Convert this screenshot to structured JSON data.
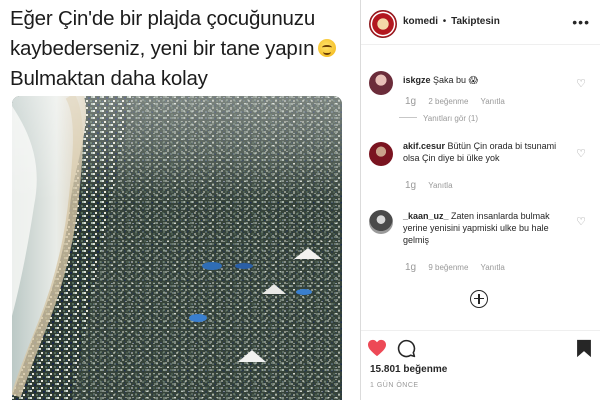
{
  "post": {
    "caption_lines": [
      "Eğer Çin'de bir plajda çocuğunuzu",
      "kaybederseniz, yeni bir tane yapın",
      "Bulmaktan daha kolay"
    ],
    "caption_emoji": "grinning-sweat-emoji"
  },
  "header": {
    "username": "komedi",
    "separator": "•",
    "follow_status": "Takiptesin",
    "more_icon": "more-options-icon"
  },
  "comments": [
    {
      "username": "iskgze",
      "text": "Şaka bu",
      "emoji": "😱",
      "time": "1g",
      "likes": "2 beğenme",
      "reply": "Yanıtla",
      "view_replies": "Yanıtları gör (1)"
    },
    {
      "username": "akif.cesur",
      "text": "Bütün Çin orada bi tsunami olsa Çin diye bi ülke yok",
      "time": "1g",
      "reply": "Yanıtla"
    },
    {
      "username": "_kaan_uz_",
      "text": "Zaten insanlarda bulmak yerine yenisini yapmiski ulke bu hale gelmiş",
      "time": "1g",
      "likes": "9 beğenme",
      "reply": "Yanıtla"
    }
  ],
  "actions": {
    "like_icon": "heart-filled-icon",
    "like_color": "#ed4956",
    "comment_icon": "comment-bubble-icon",
    "save_icon": "bookmark-filled-icon",
    "load_more_icon": "plus-circle-icon"
  },
  "stats": {
    "likes": "15.801 beğenme",
    "time": "1 GÜN ÖNCE"
  }
}
